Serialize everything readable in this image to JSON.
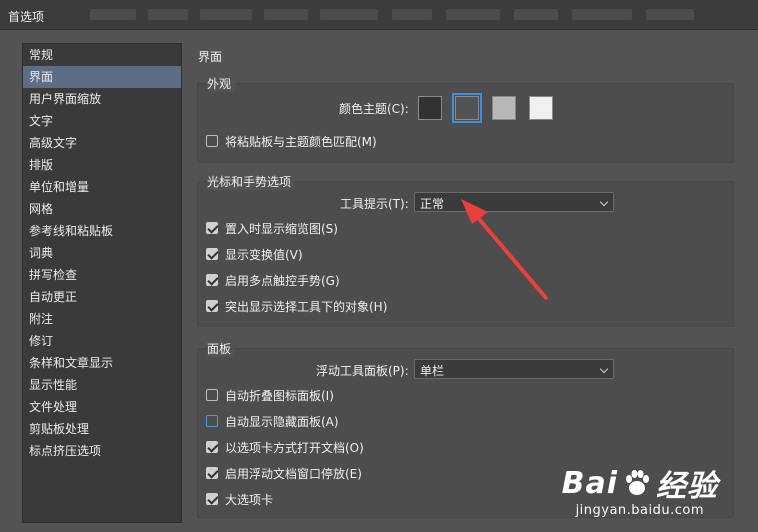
{
  "window": {
    "title": "首选项"
  },
  "sidebar": {
    "items": [
      {
        "label": "常规",
        "selected": false
      },
      {
        "label": "界面",
        "selected": true
      },
      {
        "label": "用户界面缩放",
        "selected": false
      },
      {
        "label": "文字",
        "selected": false
      },
      {
        "label": "高级文字",
        "selected": false
      },
      {
        "label": "排版",
        "selected": false
      },
      {
        "label": "单位和增量",
        "selected": false
      },
      {
        "label": "网格",
        "selected": false
      },
      {
        "label": "参考线和粘贴板",
        "selected": false
      },
      {
        "label": "词典",
        "selected": false
      },
      {
        "label": "拼写检查",
        "selected": false
      },
      {
        "label": "自动更正",
        "selected": false
      },
      {
        "label": "附注",
        "selected": false
      },
      {
        "label": "修订",
        "selected": false
      },
      {
        "label": "条样和文章显示",
        "selected": false
      },
      {
        "label": "显示性能",
        "selected": false
      },
      {
        "label": "文件处理",
        "selected": false
      },
      {
        "label": "剪贴板处理",
        "selected": false
      },
      {
        "label": "标点挤压选项",
        "selected": false
      }
    ]
  },
  "main": {
    "heading": "界面",
    "appearance": {
      "legend": "外观",
      "color_theme_label": "颜色主题(C):",
      "themes": [
        {
          "color": "#323232",
          "selected": false
        },
        {
          "color": "#535353",
          "selected": true
        },
        {
          "color": "#b8b8b8",
          "selected": false
        },
        {
          "color": "#f0f0f0",
          "selected": false
        }
      ],
      "match_pasteboard": {
        "label": "将粘贴板与主题颜色匹配(M)",
        "checked": false
      }
    },
    "cursor": {
      "legend": "光标和手势选项",
      "tooltips_label": "工具提示(T):",
      "tooltips_value": "正常",
      "options": [
        {
          "label": "置入时显示缩览图(S)",
          "checked": true
        },
        {
          "label": "显示变换值(V)",
          "checked": true
        },
        {
          "label": "启用多点触控手势(G)",
          "checked": true
        },
        {
          "label": "突出显示选择工具下的对象(H)",
          "checked": true
        }
      ]
    },
    "panels": {
      "legend": "面板",
      "floating_label": "浮动工具面板(P):",
      "floating_value": "单栏",
      "options": [
        {
          "label": "自动折叠图标面板(I)",
          "checked": false,
          "focused": false
        },
        {
          "label": "自动显示隐藏面板(A)",
          "checked": false,
          "focused": true
        },
        {
          "label": "以选项卡方式打开文档(O)",
          "checked": true,
          "focused": false
        },
        {
          "label": "启用浮动文档窗口停放(E)",
          "checked": true,
          "focused": false
        },
        {
          "label": "大选项卡",
          "checked": true,
          "focused": false
        }
      ]
    }
  },
  "annotation": {
    "arrow_color": "#e8413a"
  },
  "watermark": {
    "brand_left": "Bai",
    "brand_right": "经验",
    "sub": "jingyan.baidu.com"
  }
}
